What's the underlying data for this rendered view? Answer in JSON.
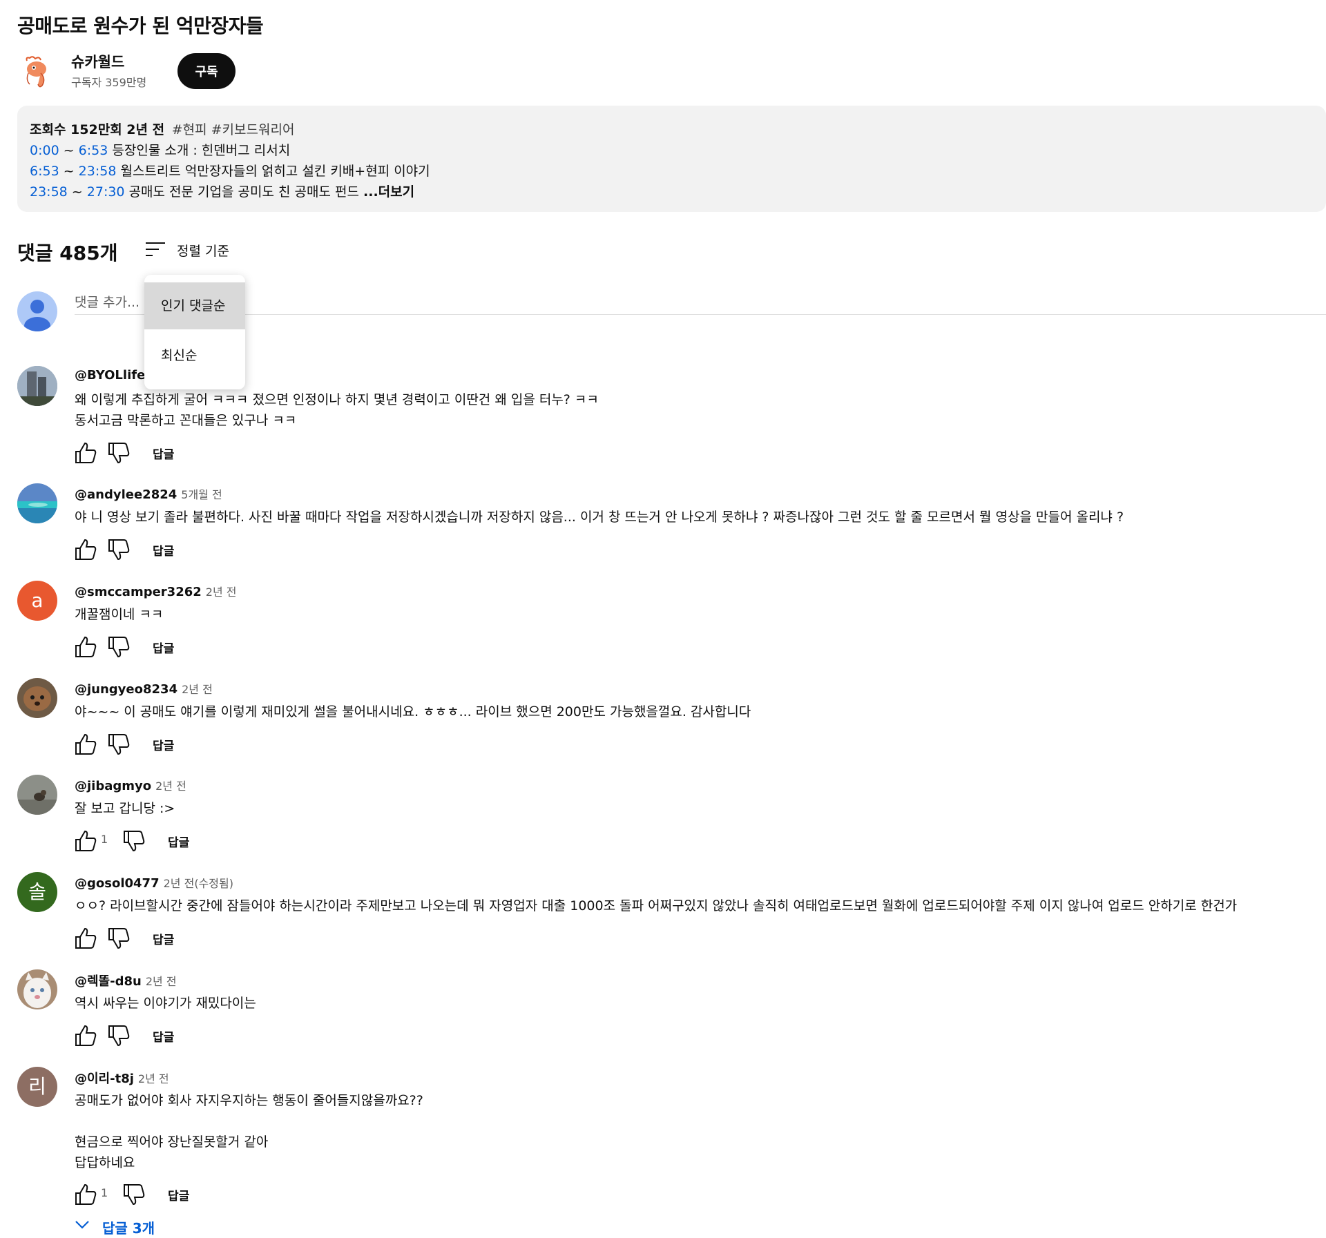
{
  "video": {
    "title": "공매도로 원수가 된 억만장자들",
    "channel_name": "슈카월드",
    "subscribers": "구독자 359만명",
    "subscribe_label": "구독"
  },
  "description": {
    "meta": "조회수 152만회  2년 전",
    "tags": "#현피 #키보드워리어",
    "chapters": [
      {
        "start": "0:00",
        "sep": " ~ ",
        "end": "6:53",
        "text": " 등장인물 소개 : 힌덴버그 리서치"
      },
      {
        "start": "6:53",
        "sep": " ~ ",
        "end": "23:58",
        "text": " 월스트리트 억만장자들의 얽히고 설킨 키배+현피 이야기"
      },
      {
        "start": "23:58",
        "sep": " ~ ",
        "end": "27:30",
        "text": " 공매도 전문 기업을 공미도 친 공매도 펀드 "
      }
    ],
    "more_label": "...더보기"
  },
  "comments_header": {
    "count_label": "댓글 485개",
    "sort_label": "정렬 기준",
    "sort_options": [
      "인기 댓글순",
      "최신순"
    ],
    "selected_sort": "인기 댓글순"
  },
  "add_comment": {
    "placeholder": "댓글 추가..."
  },
  "comments": [
    {
      "author": "@BYOLlife",
      "time": "",
      "text": "왜 이렇게 추집하게 굴어 ㅋㅋㅋ 졌으면 인정이나 하지 몇년 경력이고 이딴건 왜 입을 터누? ㅋㅋ\n동서고금 막론하고 꼰대들은 있구나 ㅋㅋ",
      "likes": "",
      "reply_label": "답글",
      "avatar": "building-photo"
    },
    {
      "author": "@andylee2824",
      "time": "5개월 전",
      "text": "야 니 영상 보기 졸라 불편하다.   사진 바꿀 때마다 작업을 저장하시겠습니까   저장하지 않음... 이거 창 뜨는거 안 나오게 못하냐 ?   짜증나잖아  그런 것도 할 줄 모르면서 뭘 영상을 만들어 올리냐 ?",
      "likes": "",
      "reply_label": "답글",
      "avatar": "beach-photo"
    },
    {
      "author": "@smccamper3262",
      "time": "2년 전",
      "text": "개꿀잼이네 ㅋㅋ",
      "likes": "",
      "reply_label": "답글",
      "avatar_letter": "a",
      "avatar_color": "#e8582f"
    },
    {
      "author": "@jungyeo8234",
      "time": "2년 전",
      "text": "야~~~  이 공매도 얘기를 이렇게 재미있게 썰을 불어내시네요.   ㅎㅎㅎ...  라이브 했으면 200만도 가능했을껄요.   감사합니다",
      "likes": "",
      "reply_label": "답글",
      "avatar": "dog-photo"
    },
    {
      "author": "@jibagmyo",
      "time": "2년 전",
      "text": "잘 보고 갑니당 :>",
      "likes": "1",
      "reply_label": "답글",
      "avatar": "cat-street-photo"
    },
    {
      "author": "@gosol0477",
      "time": "2년 전(수정됨)",
      "text": "ㅇㅇ? 라이브할시간 중간에 잠들어야 하는시간이라 주제만보고 나오는데 뭐 자영업자 대출 1000조 돌파 어쩌구있지 않았나 솔직히 여태업로드보면 월화에 업로드되어야할 주제 이지 않나여 업로드 안하기로 한건가",
      "likes": "",
      "reply_label": "답글",
      "avatar_letter": "솔",
      "avatar_color": "#33691e"
    },
    {
      "author": "@렉똘-d8u",
      "time": "2년 전",
      "text": "역시 싸우는 이야기가 재밌다이는",
      "likes": "",
      "reply_label": "답글",
      "avatar": "white-cat-photo"
    },
    {
      "author": "@이리-t8j",
      "time": "2년 전",
      "text": "공매도가 없어야 회사 자지우지하는 행동이 줄어들지않을까요??\n\n현금으로 찍어야 장난질못할거 같아\n답답하네요",
      "likes": "1",
      "reply_label": "답글",
      "avatar_letter": "리",
      "avatar_color": "#8d6e63",
      "replies_label": "답글 3개"
    }
  ]
}
